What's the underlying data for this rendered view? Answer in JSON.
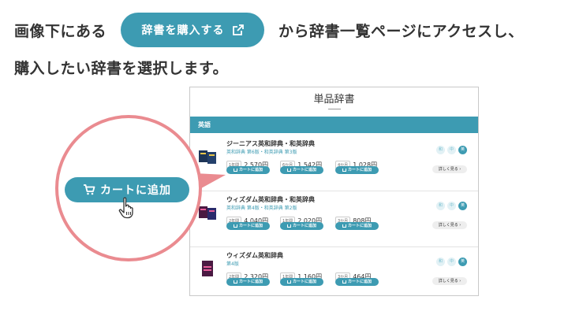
{
  "instructions": {
    "prefix": "画像下にある",
    "buy_button": "辞書を購入する",
    "suffix": "から辞書一覧ページにアクセスし、",
    "line2": "購入したい辞書を選択します。"
  },
  "panel": {
    "title": "単品辞書",
    "category": "英語",
    "items": [
      {
        "name": "ジーニアス英和辞典・和英辞典",
        "edition": "英和辞典 第6版・和英辞典 第3版",
        "plans": [
          {
            "duration": "1年間",
            "price": "2,570円",
            "cart": "カートに追加"
          },
          {
            "duration": "6か月",
            "price": "1,542円",
            "cart": "カートに追加"
          },
          {
            "duration": "4か月",
            "price": "1,028円",
            "cart": "カートに追加"
          }
        ],
        "chips": [
          "和",
          "中",
          "英"
        ],
        "detail": "詳しく見る ›"
      },
      {
        "name": "ウィズダム英和辞典・和英辞典",
        "edition": "英和辞典 第4版・和英辞典 第2版",
        "plans": [
          {
            "duration": "2年間",
            "price": "4,040円",
            "cart": "カートに追加"
          },
          {
            "duration": "1年間",
            "price": "2,020円",
            "cart": "カートに追加"
          },
          {
            "duration": "3か月",
            "price": "808円",
            "cart": "カートに追加"
          }
        ],
        "chips": [
          "和",
          "中",
          "英"
        ],
        "detail": "詳しく見る ›"
      },
      {
        "name": "ウィズダム英和辞典",
        "edition": "第4版",
        "plans": [
          {
            "duration": "2年間",
            "price": "2,320円",
            "cart": "カートに追加"
          },
          {
            "duration": "1年間",
            "price": "1,160円",
            "cart": "カートに追加"
          },
          {
            "duration": "3か月",
            "price": "464円",
            "cart": "カートに追加"
          }
        ],
        "chips": [
          "和",
          "中",
          "英"
        ],
        "detail": "詳しく見る ›"
      }
    ]
  },
  "magnifier": {
    "button_label": "カートに追加"
  },
  "colors": {
    "teal": "#3d9bb2",
    "pink": "#ea8b90",
    "text": "#333333"
  },
  "icons": [
    "external-link-icon",
    "cart-icon",
    "hand-pointer-icon"
  ]
}
